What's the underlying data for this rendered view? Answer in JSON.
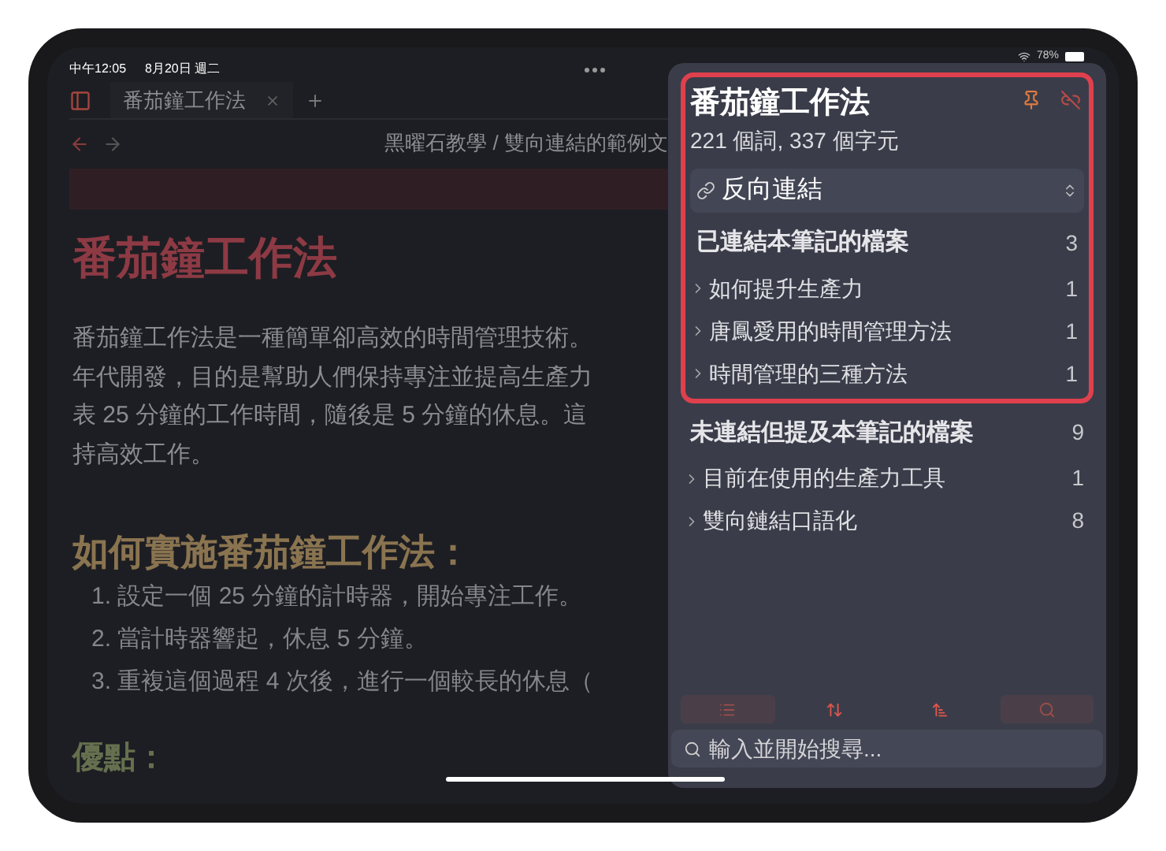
{
  "status_bar": {
    "time": "中午12:05",
    "date": "8月20日 週二",
    "battery": "78%"
  },
  "tab": {
    "title": "番茄鐘工作法"
  },
  "breadcrumb": "黑曜石教學 / 雙向連結的範例文",
  "note": {
    "title": "番茄鐘工作法",
    "paragraph_lines": [
      "番茄鐘工作法是一種簡單卻高效的時間管理技術。",
      "年代開發，目的是幫助人們保持專注並提高生產力",
      "表 25 分鐘的工作時間，隨後是 5 分鐘的休息。這",
      "持高效工作。"
    ],
    "heading": "如何實施番茄鐘工作法：",
    "steps": [
      "1. 設定一個 25 分鐘的計時器，開始專注工作。",
      "2. 當計時器響起，休息 5 分鐘。",
      "3. 重複這個過程 4 次後，進行一個較長的休息（"
    ],
    "subheading": "優點："
  },
  "panel": {
    "title": "番茄鐘工作法",
    "stats": "221 個詞, 337 個字元",
    "view": "反向連結",
    "sections": [
      {
        "title": "已連結本筆記的檔案",
        "count": "3",
        "highlighted": true,
        "items": [
          {
            "name": "如何提升生產力",
            "count": "1"
          },
          {
            "name": "唐鳳愛用的時間管理方法",
            "count": "1"
          },
          {
            "name": "時間管理的三種方法",
            "count": "1"
          }
        ]
      },
      {
        "title": "未連結但提及本筆記的檔案",
        "count": "9",
        "highlighted": false,
        "items": [
          {
            "name": "目前在使用的生產力工具",
            "count": "1"
          },
          {
            "name": "雙向鏈結口語化",
            "count": "8"
          }
        ]
      }
    ],
    "toolbar": [
      {
        "kind": "list",
        "selected": true
      },
      {
        "kind": "expand",
        "selected": false
      },
      {
        "kind": "sort",
        "selected": false
      },
      {
        "kind": "search",
        "selected": true
      }
    ],
    "search": {
      "placeholder": "輸入並開始搜尋..."
    }
  }
}
